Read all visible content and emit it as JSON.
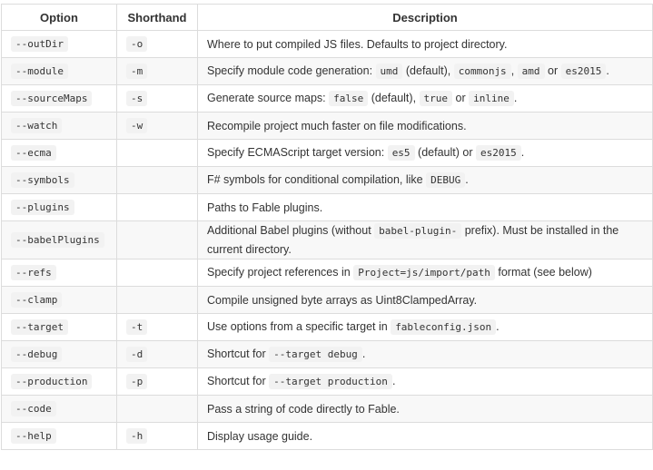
{
  "headers": [
    "Option",
    "Shorthand",
    "Description"
  ],
  "rows": [
    {
      "option": "--outDir",
      "shorthand": "-o",
      "desc": [
        {
          "t": "Where to put compiled JS files. Defaults to project directory."
        }
      ]
    },
    {
      "option": "--module",
      "shorthand": "-m",
      "desc": [
        {
          "t": "Specify module code generation: "
        },
        {
          "c": "umd"
        },
        {
          "t": " (default), "
        },
        {
          "c": "commonjs"
        },
        {
          "t": ", "
        },
        {
          "c": "amd"
        },
        {
          "t": " or "
        },
        {
          "c": "es2015"
        },
        {
          "t": "."
        }
      ]
    },
    {
      "option": "--sourceMaps",
      "shorthand": "-s",
      "desc": [
        {
          "t": "Generate source maps: "
        },
        {
          "c": "false"
        },
        {
          "t": " (default), "
        },
        {
          "c": "true"
        },
        {
          "t": " or "
        },
        {
          "c": "inline"
        },
        {
          "t": "."
        }
      ]
    },
    {
      "option": "--watch",
      "shorthand": "-w",
      "desc": [
        {
          "t": "Recompile project much faster on file modifications."
        }
      ]
    },
    {
      "option": "--ecma",
      "shorthand": "",
      "desc": [
        {
          "t": "Specify ECMAScript target version: "
        },
        {
          "c": "es5"
        },
        {
          "t": " (default) or "
        },
        {
          "c": "es2015"
        },
        {
          "t": "."
        }
      ]
    },
    {
      "option": "--symbols",
      "shorthand": "",
      "desc": [
        {
          "t": "F# symbols for conditional compilation, like "
        },
        {
          "c": "DEBUG"
        },
        {
          "t": "."
        }
      ]
    },
    {
      "option": "--plugins",
      "shorthand": "",
      "desc": [
        {
          "t": "Paths to Fable plugins."
        }
      ]
    },
    {
      "option": "--babelPlugins",
      "shorthand": "",
      "tall": true,
      "desc": [
        {
          "t": "Additional Babel plugins (without "
        },
        {
          "c": "babel-plugin-"
        },
        {
          "t": " prefix). Must be installed in the current directory."
        }
      ]
    },
    {
      "option": "--refs",
      "shorthand": "",
      "desc": [
        {
          "t": "Specify project references in "
        },
        {
          "c": "Project=js/import/path"
        },
        {
          "t": " format (see below)"
        }
      ]
    },
    {
      "option": "--clamp",
      "shorthand": "",
      "desc": [
        {
          "t": "Compile unsigned byte arrays as Uint8ClampedArray."
        }
      ]
    },
    {
      "option": "--target",
      "shorthand": "-t",
      "desc": [
        {
          "t": "Use options from a specific target in "
        },
        {
          "c": "fableconfig.json"
        },
        {
          "t": "."
        }
      ]
    },
    {
      "option": "--debug",
      "shorthand": "-d",
      "desc": [
        {
          "t": "Shortcut for "
        },
        {
          "c": "--target debug"
        },
        {
          "t": "."
        }
      ]
    },
    {
      "option": "--production",
      "shorthand": "-p",
      "desc": [
        {
          "t": "Shortcut for "
        },
        {
          "c": "--target production"
        },
        {
          "t": "."
        }
      ]
    },
    {
      "option": "--code",
      "shorthand": "",
      "desc": [
        {
          "t": "Pass a string of code directly to Fable."
        }
      ]
    },
    {
      "option": "--help",
      "shorthand": "-h",
      "desc": [
        {
          "t": "Display usage guide."
        }
      ]
    }
  ]
}
